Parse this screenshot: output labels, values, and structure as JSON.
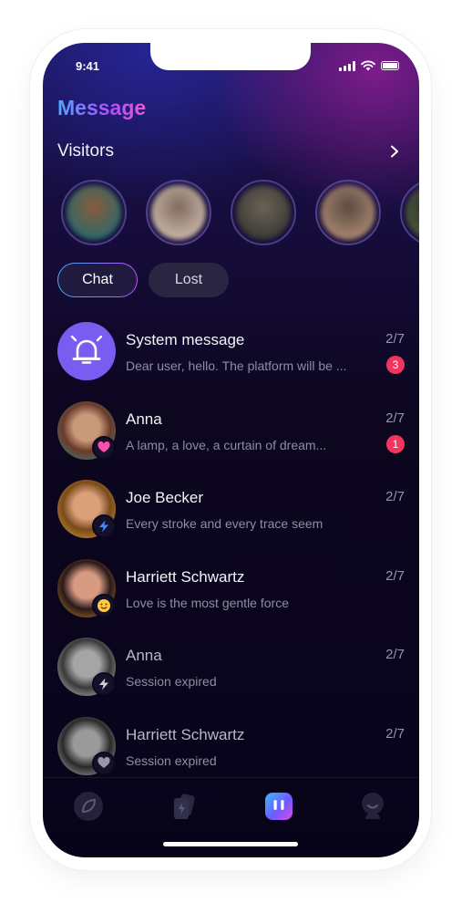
{
  "status": {
    "time": "9:41"
  },
  "header": {
    "title": "Message"
  },
  "visitors": {
    "title": "Visitors",
    "avatars": [
      {
        "colors": [
          "#2b6a6a",
          "#8b5a3a"
        ]
      },
      {
        "colors": [
          "#c9b6a8",
          "#7f6a5f"
        ]
      },
      {
        "colors": [
          "#3a3a35",
          "#6d6256"
        ]
      },
      {
        "colors": [
          "#a88770",
          "#5a4a40"
        ]
      },
      {
        "colors": [
          "#4a5a3a",
          "#2a2a2a"
        ]
      }
    ]
  },
  "tabs": [
    {
      "label": "Chat",
      "active": true
    },
    {
      "label": "Lost",
      "active": false
    }
  ],
  "messages": [
    {
      "name": "System message",
      "preview": "Dear user, hello. The platform will be ...",
      "date": "2/7",
      "unread": "3",
      "type": "system",
      "dim": false
    },
    {
      "name": "Anna",
      "preview": "A lamp, a love, a curtain of dream...",
      "date": "2/7",
      "unread": "1",
      "type": "heart",
      "dim": false
    },
    {
      "name": "Joe Becker",
      "preview": "Every stroke and every trace seem",
      "date": "2/7",
      "unread": "",
      "type": "bolt",
      "dim": false
    },
    {
      "name": "Harriett Schwartz",
      "preview": "Love is the most gentle force",
      "date": "2/7",
      "unread": "",
      "type": "emoji",
      "dim": false
    },
    {
      "name": "Anna",
      "preview": "Session expired",
      "date": "2/7",
      "unread": "",
      "type": "bolt-grey",
      "dim": true
    },
    {
      "name": "Harriett Schwartz",
      "preview": "Session expired",
      "date": "2/7",
      "unread": "",
      "type": "heart-grey",
      "dim": true
    }
  ],
  "colors": {
    "accent_start": "#4fa8ff",
    "accent_end": "#c64cff",
    "system_avatar": "#7a5cf0",
    "unread_badge": "#f3345e"
  },
  "tabbar": {
    "items": [
      {
        "icon": "leaf-icon",
        "active": false
      },
      {
        "icon": "cards-icon",
        "active": false
      },
      {
        "icon": "chat-icon",
        "active": true
      },
      {
        "icon": "profile-icon",
        "active": false
      }
    ]
  }
}
